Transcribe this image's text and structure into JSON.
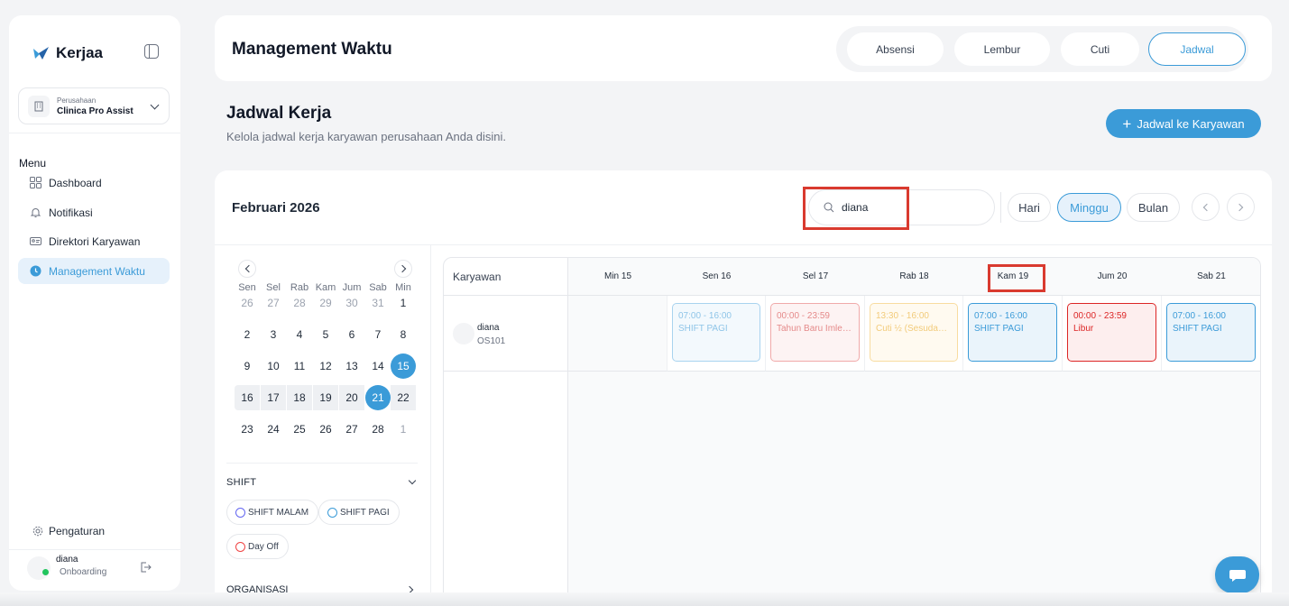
{
  "app": {
    "name": "Kerjaa",
    "brand_color": "#3b9bd8"
  },
  "sidebar": {
    "company_label": "Perusahaan",
    "company_name": "Clinica Pro Assist",
    "menu_label": "Menu",
    "items": [
      {
        "label": "Dashboard",
        "icon": "grid-icon"
      },
      {
        "label": "Notifikasi",
        "icon": "bell-icon"
      },
      {
        "label": "Direktori Karyawan",
        "icon": "id-card-icon"
      },
      {
        "label": "Management Waktu",
        "icon": "clock-icon",
        "active": true
      }
    ],
    "settings_label": "Pengaturan",
    "user": {
      "name": "diana",
      "status": "Onboarding",
      "status_color": "#22c55e"
    }
  },
  "header": {
    "title": "Management Waktu",
    "tabs": [
      {
        "label": "Absensi"
      },
      {
        "label": "Lembur"
      },
      {
        "label": "Cuti"
      },
      {
        "label": "Jadwal",
        "active": true
      }
    ]
  },
  "page": {
    "title": "Jadwal Kerja",
    "subtitle": "Kelola jadwal kerja karyawan perusahaan Anda disini.",
    "add_button": "Jadwal ke Karyawan"
  },
  "toolbar": {
    "month": "Februari 2026",
    "search_value": "diana",
    "views": [
      {
        "label": "Hari"
      },
      {
        "label": "Minggu",
        "active": true
      },
      {
        "label": "Bulan"
      }
    ]
  },
  "mini_calendar": {
    "weekdays": [
      "Sen",
      "Sel",
      "Rab",
      "Kam",
      "Jum",
      "Sab",
      "Min"
    ],
    "weeks": [
      [
        "26",
        "27",
        "28",
        "29",
        "30",
        "31",
        "1"
      ],
      [
        "2",
        "3",
        "4",
        "5",
        "6",
        "7",
        "8"
      ],
      [
        "9",
        "10",
        "11",
        "12",
        "13",
        "14",
        "15"
      ],
      [
        "16",
        "17",
        "18",
        "19",
        "20",
        "21",
        "22"
      ],
      [
        "23",
        "24",
        "25",
        "26",
        "27",
        "28",
        "1"
      ]
    ],
    "selected": [
      "15",
      "21"
    ]
  },
  "shift_section": {
    "title": "SHIFT",
    "items": [
      {
        "label": "SHIFT MALAM",
        "color": "#6366f1"
      },
      {
        "label": "SHIFT PAGI",
        "color": "#3b9bd8"
      },
      {
        "label": "Day Off",
        "color": "#ef4444"
      }
    ]
  },
  "org_section": {
    "title": "ORGANISASI"
  },
  "schedule": {
    "employee_header": "Karyawan",
    "days": [
      "Min 15",
      "Sen 16",
      "Sel 17",
      "Rab 18",
      "Kam 19",
      "Jum 20",
      "Sab 21"
    ],
    "employee": {
      "name": "diana",
      "code": "OS101"
    },
    "events": [
      null,
      {
        "time": "07:00 - 16:00",
        "label": "SHIFT PAGI",
        "kind": "pagi-faded"
      },
      {
        "time": "00:00 - 23:59",
        "label": "Tahun Baru Imlek ...",
        "kind": "holiday-faded"
      },
      {
        "time": "13:30 - 16:00",
        "label": "Cuti ½ (Sesudah I...",
        "kind": "leave-faded"
      },
      {
        "time": "07:00 - 16:00",
        "label": "SHIFT PAGI",
        "kind": "pagi"
      },
      {
        "time": "00:00 - 23:59",
        "label": "Libur",
        "kind": "off"
      },
      {
        "time": "07:00 - 16:00",
        "label": "SHIFT PAGI",
        "kind": "pagi"
      }
    ]
  }
}
